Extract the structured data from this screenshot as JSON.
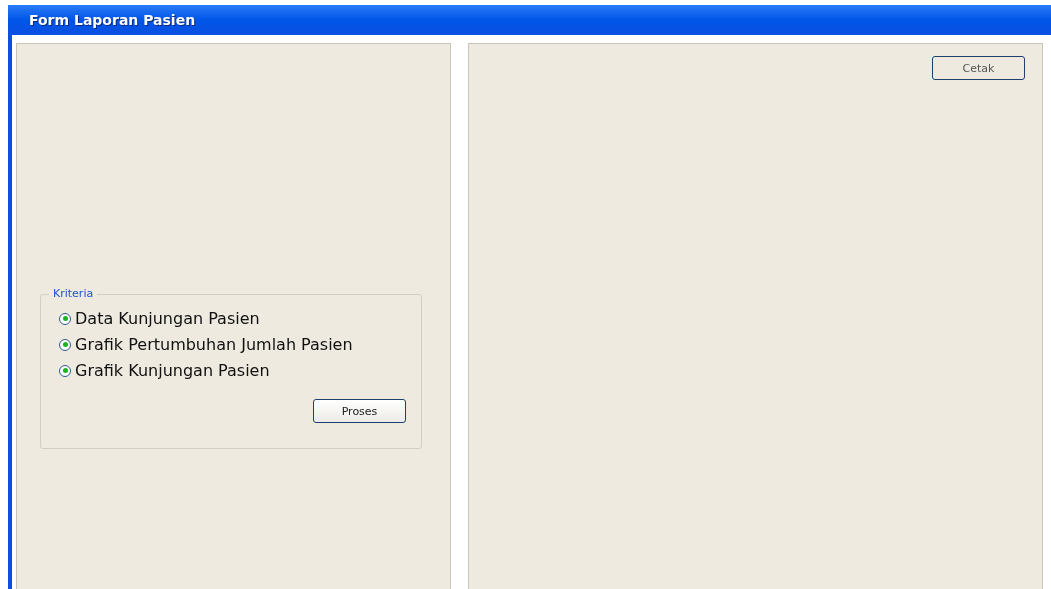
{
  "window": {
    "title": "Form Laporan Pasien"
  },
  "kriteria": {
    "title": "Kriteria",
    "options": [
      {
        "label": "Data Kunjungan Pasien",
        "selected": true
      },
      {
        "label": "Grafik Pertumbuhan Jumlah Pasien",
        "selected": true
      },
      {
        "label": "Grafik Kunjungan Pasien",
        "selected": true
      }
    ],
    "button": "Proses"
  },
  "preview": {
    "button": "Cetak"
  }
}
